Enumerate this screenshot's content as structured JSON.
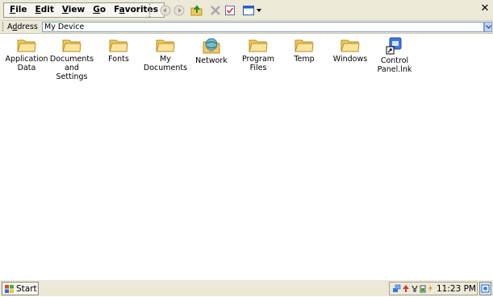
{
  "menu": {
    "items": [
      {
        "accel": "F",
        "rest": "ile"
      },
      {
        "accel": "E",
        "rest": "dit"
      },
      {
        "accel": "V",
        "rest": "iew"
      },
      {
        "accel": "G",
        "rest": "o"
      },
      {
        "accel": "F",
        "rest": "avorites",
        "prefix": ""
      }
    ]
  },
  "toolbar_icons": [
    "back-icon",
    "forward-icon",
    "up-folder-icon",
    "delete-icon",
    "properties-icon",
    "view-menu-icon"
  ],
  "address": {
    "label": "Address",
    "value": "My Device"
  },
  "files": [
    {
      "label": "Application Data",
      "line1": "Application",
      "line2": "Data",
      "icon": "folder-icon"
    },
    {
      "label": "Documents and Settings",
      "line1": "Documents",
      "line2": "and Settings",
      "icon": "folder-icon"
    },
    {
      "label": "Fonts",
      "line1": "Fonts",
      "line2": "",
      "icon": "folder-icon"
    },
    {
      "label": "My Documents",
      "line1": "My",
      "line2": "Documents",
      "icon": "folder-icon"
    },
    {
      "label": "Network",
      "line1": "Network",
      "line2": "",
      "icon": "network-icon"
    },
    {
      "label": "Program Files",
      "line1": "Program Files",
      "line2": "",
      "icon": "folder-icon"
    },
    {
      "label": "Temp",
      "line1": "Temp",
      "line2": "",
      "icon": "folder-icon"
    },
    {
      "label": "Windows",
      "line1": "Windows",
      "line2": "",
      "icon": "folder-icon"
    },
    {
      "label": "Control Panel.lnk",
      "line1": "Control",
      "line2": "Panel.lnk",
      "icon": "shortcut-icon"
    }
  ],
  "taskbar": {
    "start_label": "Start",
    "clock": "11:23 PM"
  }
}
